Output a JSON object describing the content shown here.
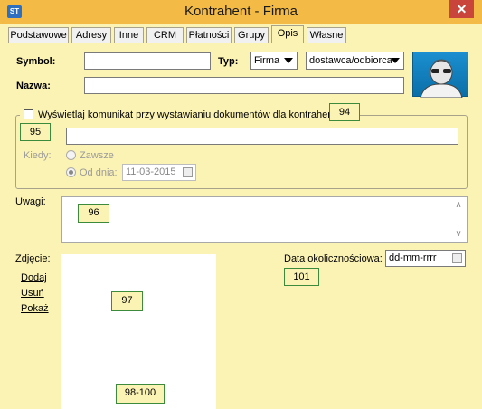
{
  "window": {
    "title": "Kontrahent - Firma",
    "app_icon_text": "ST",
    "close_glyph": "✕"
  },
  "tabs": [
    {
      "label": "Podstawowe",
      "active": false
    },
    {
      "label": "Adresy",
      "active": false
    },
    {
      "label": "Inne",
      "active": false
    },
    {
      "label": "CRM",
      "active": false
    },
    {
      "label": "Płatności",
      "active": false
    },
    {
      "label": "Grupy",
      "active": false
    },
    {
      "label": "Opis",
      "active": true
    },
    {
      "label": "Własne",
      "active": false
    }
  ],
  "form": {
    "symbol_label": "Symbol:",
    "symbol_value": "",
    "typ_label": "Typ:",
    "typ_value": "Firma",
    "role_value": "dostawca/odbiorca",
    "nazwa_label": "Nazwa:",
    "nazwa_value": ""
  },
  "notification": {
    "checkbox_label": "Wyświetlaj komunikat przy wystawianiu dokumentów dla kontrahenta",
    "checked": false,
    "message_value": "",
    "kiedy_label": "Kiedy:",
    "option_always": "Zawsze",
    "option_from": "Od dnia:",
    "selected_option": "Od dnia:",
    "date_value": "11-03-2015"
  },
  "notes": {
    "uwagi_label": "Uwagi:",
    "value": ""
  },
  "photo": {
    "label": "Zdjęcie:",
    "add": "Dodaj",
    "remove": "Usuń",
    "show": "Pokaż"
  },
  "occasion": {
    "label": "Data okolicznościowa:",
    "value": "dd-mm-rrrr"
  },
  "callouts": {
    "c94": "94",
    "c95": "95",
    "c96": "96",
    "c97": "97",
    "c98": "98-100",
    "c101": "101"
  },
  "colors": {
    "background": "#fbf3b4",
    "titlebar": "#f3ba46",
    "close": "#c9453b",
    "avatar": "#1b8fd0",
    "callout_border": "#3c8a3c"
  }
}
